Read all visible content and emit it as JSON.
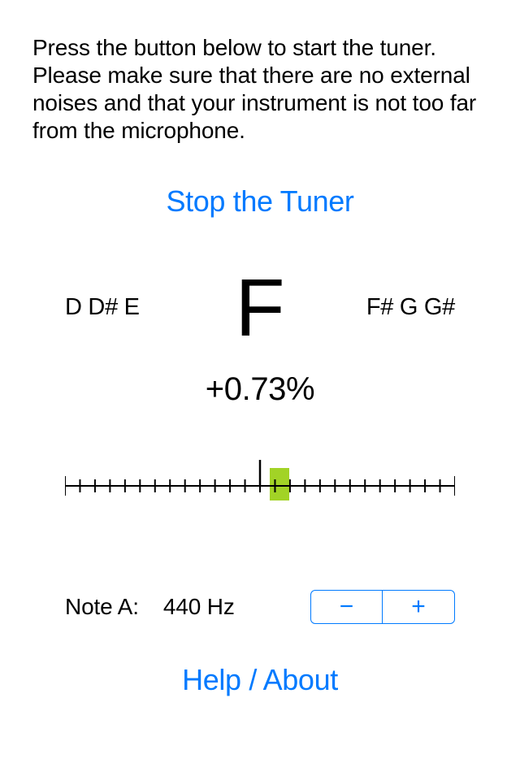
{
  "instructions_text": "Press the button below to start the tuner. Please make sure that there are no external noises and that your instrument is not too far from the microphone.",
  "toggle_label": "Stop the Tuner",
  "notes": {
    "left": "D D# E",
    "current": "F",
    "right": "F# G G#"
  },
  "deviation_text": "+0.73%",
  "deviation_percent": 0.73,
  "scale": {
    "indicator_position_percent": 55
  },
  "reference": {
    "label": "Note A:",
    "value": "440 Hz"
  },
  "stepper": {
    "minus_label": "−",
    "plus_label": "+"
  },
  "help_label": "Help / About"
}
